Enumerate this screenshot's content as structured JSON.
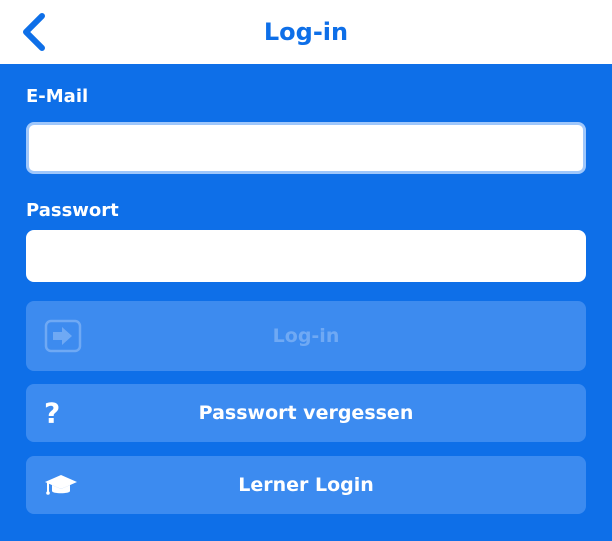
{
  "header": {
    "title": "Log-in",
    "back_icon": "chevron-left-icon"
  },
  "form": {
    "email": {
      "label": "E-Mail",
      "value": "",
      "placeholder": ""
    },
    "password": {
      "label": "Passwort",
      "value": "",
      "placeholder": ""
    }
  },
  "buttons": {
    "login": {
      "label": "Log-in",
      "icon": "sign-in-icon",
      "enabled": false
    },
    "forgot_password": {
      "label": "Passwort vergessen",
      "icon": "question-icon"
    },
    "learner_login": {
      "label": "Lerner Login",
      "icon": "graduation-cap-icon"
    }
  },
  "colors": {
    "primary_blue": "#0e6fe8",
    "button_blue": "#3c8bf0",
    "input_border_focus": "#9fc7fb",
    "disabled_text": "#6fa9f4"
  }
}
